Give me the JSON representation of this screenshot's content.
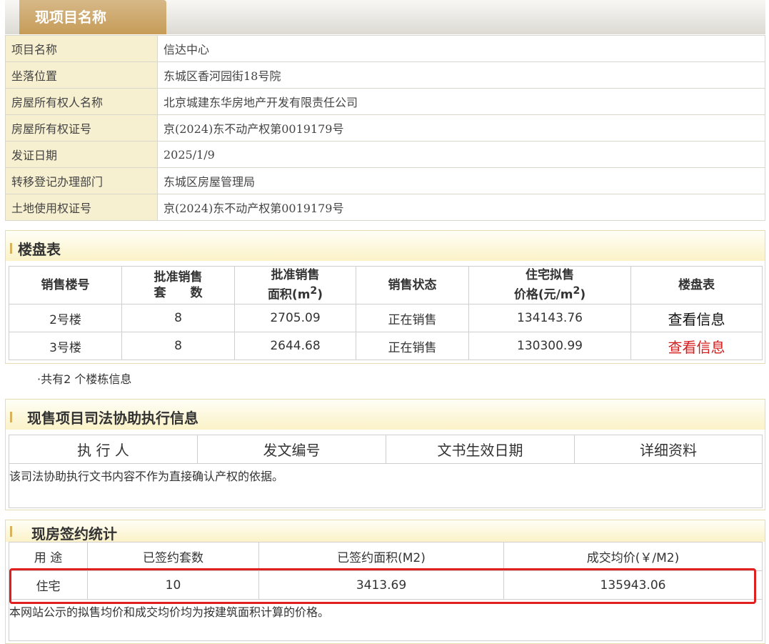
{
  "header": {
    "title": "现项目名称"
  },
  "project_info": [
    {
      "label": "项目名称",
      "value": "信达中心"
    },
    {
      "label": "坐落位置",
      "value": "东城区香河园街18号院"
    },
    {
      "label": "房屋所有权人名称",
      "value": "北京城建东华房地产开发有限责任公司"
    },
    {
      "label": "房屋所有权证号",
      "value": "京(2024)东不动产权第0019179号"
    },
    {
      "label": "发证日期",
      "value": "2025/1/9"
    },
    {
      "label": "转移登记办理部门",
      "value": "东城区房屋管理局"
    },
    {
      "label": "土地使用权证号",
      "value": "京(2024)东不动产权第0019179号"
    }
  ],
  "building_table": {
    "title": "楼盘表",
    "headers": {
      "building": "销售楼号",
      "units_line1": "批准销售",
      "units_line2": "套　　数",
      "area_line1": "批准销售",
      "area_line2": "面积(m",
      "status": "销售状态",
      "price_line1": "住宅拟售",
      "price_line2": "价格(元/m",
      "sup": "2",
      "close": ")",
      "link": "楼盘表"
    },
    "rows": [
      {
        "building": "2号楼",
        "units": "8",
        "area": "2705.09",
        "status": "正在销售",
        "price": "134143.76",
        "link": "查看信息"
      },
      {
        "building": "3号楼",
        "units": "8",
        "area": "2644.68",
        "status": "正在销售",
        "price": "130300.99",
        "link": "查看信息"
      }
    ],
    "footnote": "·共有2 个楼栋信息"
  },
  "judicial": {
    "title": "现售项目司法协助执行信息",
    "headers": [
      "执 行 人",
      "发文编号",
      "文书生效日期",
      "详细资料"
    ],
    "note": "该司法协助执行文书内容不作为直接确认产权的依据。"
  },
  "signing": {
    "title": "现房签约统计",
    "headers": [
      "用 途",
      "已签约套数",
      "已签约面积(M2)",
      "成交均价(￥/M2)"
    ],
    "row": {
      "use": "住宅",
      "count": "10",
      "area": "3413.69",
      "price": "135943.06"
    },
    "note": "本网站公示的拟售均价和成交均价均为按建筑面积计算的价格。"
  },
  "colors": {
    "highlight": "#e01f1f",
    "link_active": "#d61c1c",
    "tab": "#c69c57"
  }
}
